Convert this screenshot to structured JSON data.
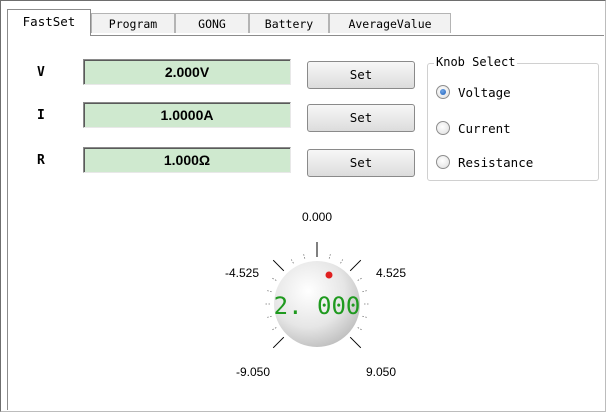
{
  "tabs": [
    {
      "label": "FastSet",
      "active": true
    },
    {
      "label": "Program",
      "active": false
    },
    {
      "label": "GONG",
      "active": false
    },
    {
      "label": "Battery",
      "active": false
    },
    {
      "label": "AverageValue",
      "active": false
    }
  ],
  "fast_set": {
    "rows": [
      {
        "label": "V",
        "value": "2.000V",
        "button": "Set"
      },
      {
        "label": "I",
        "value": "1.0000A",
        "button": "Set"
      },
      {
        "label": "R",
        "value": "1.000Ω",
        "button": "Set"
      }
    ]
  },
  "knob_select": {
    "title": "Knob Select",
    "options": [
      "Voltage",
      "Current",
      "Resistance"
    ],
    "selected": "Voltage"
  },
  "knob": {
    "value": "2. 000",
    "ticks": {
      "top": "0.000",
      "upper_left": "-4.525",
      "upper_right": "4.525",
      "lower_left": "-9.050",
      "lower_right": "9.050"
    }
  },
  "colors": {
    "field_bg": "#cfe9cf",
    "knob_value": "#1f9a1f",
    "indicator": "#e02020"
  }
}
